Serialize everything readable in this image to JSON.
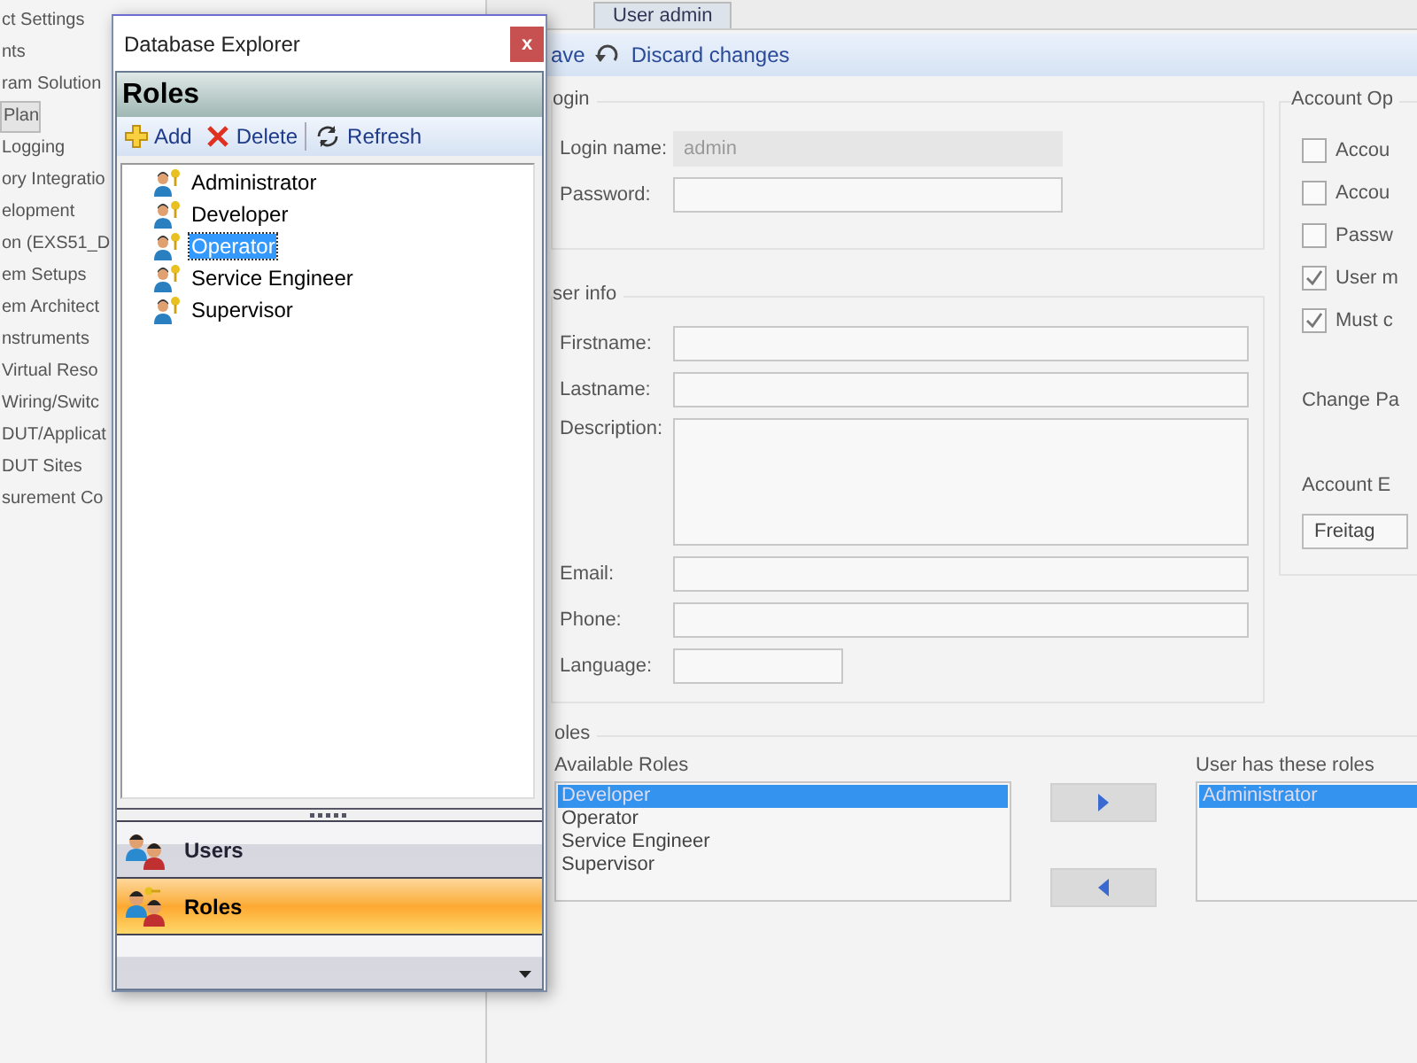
{
  "background_tree": {
    "items": [
      {
        "label": "ct Settings",
        "selected": false
      },
      {
        "label": "nts",
        "selected": false
      },
      {
        "label": "ram Solution",
        "selected": false
      },
      {
        "label": "Plan",
        "selected": true
      },
      {
        "label": "Logging",
        "selected": false
      },
      {
        "label": "ory Integratio",
        "selected": false
      },
      {
        "label": "elopment",
        "selected": false
      },
      {
        "label": "on (EXS51_D",
        "selected": false
      },
      {
        "label": "em Setups",
        "selected": false
      },
      {
        "label": "em Architect",
        "selected": false
      },
      {
        "label": "nstruments",
        "selected": false
      },
      {
        "label": "Virtual Reso",
        "selected": false
      },
      {
        "label": "Wiring/Switc",
        "selected": false
      },
      {
        "label": "DUT/Applicat",
        "selected": false
      },
      {
        "label": "DUT Sites",
        "selected": false
      },
      {
        "label": "surement Co",
        "selected": false
      }
    ]
  },
  "editor": {
    "tab": "User admin",
    "save_label": "ave",
    "discard_label": "Discard changes",
    "login": {
      "legend": "ogin",
      "fields": [
        {
          "label": "Login name:",
          "value": "admin",
          "disabled": true
        },
        {
          "label": "Password:",
          "disabled": false
        }
      ]
    },
    "user_info": {
      "legend": "ser info",
      "fields": [
        {
          "label": "Firstname:",
          "kind": "line"
        },
        {
          "label": "Lastname:",
          "kind": "line"
        },
        {
          "label": "Description:",
          "kind": "multiline"
        },
        {
          "label": "Email:",
          "kind": "line"
        },
        {
          "label": "Phone:",
          "kind": "line"
        },
        {
          "label": "Language:",
          "kind": "short"
        }
      ]
    },
    "account_options": {
      "legend": "Account Op",
      "options": [
        {
          "label": "Accou",
          "checked": false
        },
        {
          "label": "Accou",
          "checked": false
        },
        {
          "label": "Passw",
          "checked": false
        },
        {
          "label": "User m",
          "checked": true
        },
        {
          "label": "Must c",
          "checked": true
        }
      ],
      "change_password_label": "Change Pa",
      "expiry_label": "Account E",
      "expiry_value": "Freitag"
    },
    "roles": {
      "legend": "oles",
      "available_label": "Available Roles",
      "available": [
        {
          "label": "Developer",
          "selected": true
        },
        {
          "label": "Operator",
          "selected": false
        },
        {
          "label": "Service Engineer",
          "selected": false
        },
        {
          "label": "Supervisor",
          "selected": false
        }
      ],
      "assigned_label": "User has these roles",
      "assigned": [
        {
          "label": "Administrator",
          "selected": true
        }
      ]
    }
  },
  "explorer": {
    "title": "Database Explorer",
    "close": "x",
    "header": "Roles",
    "actions": [
      {
        "label": "Add",
        "kind": "add"
      },
      {
        "label": "Delete",
        "kind": "delete"
      },
      {
        "label": "Refresh",
        "kind": "refresh"
      }
    ],
    "items": [
      {
        "label": "Administrator",
        "selected": false
      },
      {
        "label": "Developer",
        "selected": false
      },
      {
        "label": "Operator",
        "selected": true
      },
      {
        "label": "Service Engineer",
        "selected": false
      },
      {
        "label": "Supervisor",
        "selected": false
      }
    ],
    "nav": [
      {
        "label": "Users",
        "kind": "users",
        "selected": false
      },
      {
        "label": "Roles",
        "kind": "roles",
        "selected": true
      }
    ]
  }
}
